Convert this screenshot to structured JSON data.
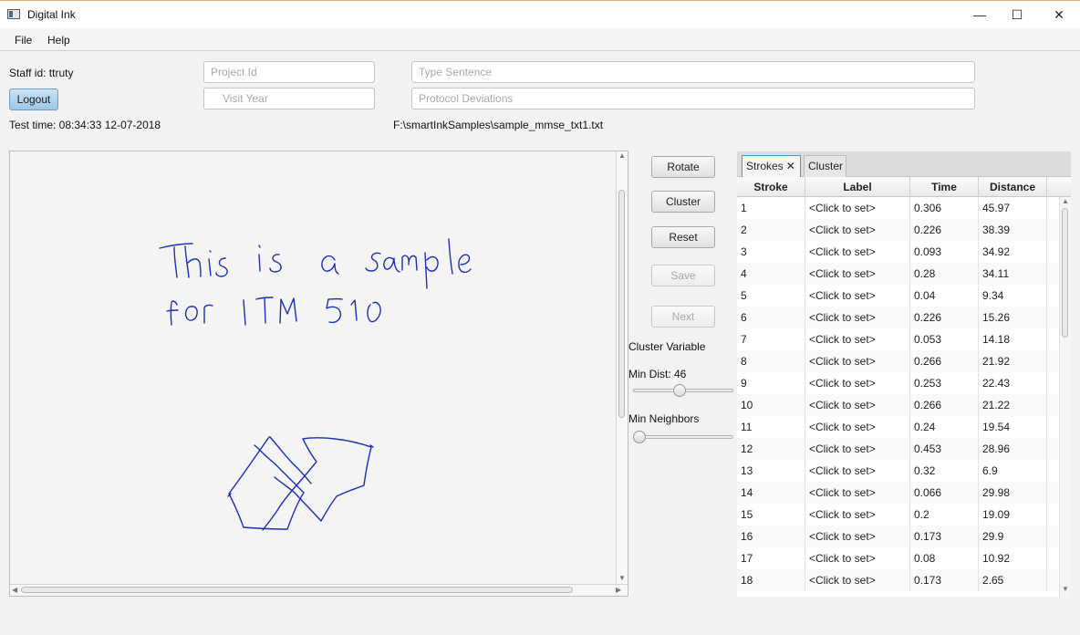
{
  "window": {
    "title": "Digital Ink",
    "minimize": "—",
    "maximize": "☐",
    "close": "✕"
  },
  "menu": {
    "file": "File",
    "help": "Help"
  },
  "header": {
    "staff": "Staff id: ttruty",
    "logout": "Logout",
    "test_time": "Test time: 08:34:33 12-07-2018",
    "file_path": "F:\\smartInkSamples\\sample_mmse_txt1.txt",
    "project_id_placeholder": "Project Id",
    "visit_year_placeholder": "Visit Year",
    "type_sentence_placeholder": "Type Sentence",
    "protocol_placeholder": "Protocol Deviations"
  },
  "controls": {
    "rotate": "Rotate",
    "cluster": "Cluster",
    "reset": "Reset",
    "save": "Save",
    "next": "Next",
    "cluster_variable": "Cluster  Variable",
    "min_dist_label": "Min Dist: 46",
    "min_neighbors_label": "Min Neighbors",
    "min_dist_slider_fraction": 0.46,
    "min_neighbors_slider_fraction": 0.0
  },
  "tabs": {
    "strokes": "Strokes",
    "cluster": "Cluster"
  },
  "table": {
    "headers": [
      "Stroke",
      "Label",
      "Time",
      "Distance"
    ],
    "rows": [
      [
        "1",
        "<Click to set>",
        "0.306",
        "45.97"
      ],
      [
        "2",
        "<Click to set>",
        "0.226",
        "38.39"
      ],
      [
        "3",
        "<Click to set>",
        "0.093",
        "34.92"
      ],
      [
        "4",
        "<Click to set>",
        "0.28",
        "34.11"
      ],
      [
        "5",
        "<Click to set>",
        "0.04",
        "9.34"
      ],
      [
        "6",
        "<Click to set>",
        "0.226",
        "15.26"
      ],
      [
        "7",
        "<Click to set>",
        "0.053",
        "14.18"
      ],
      [
        "8",
        "<Click to set>",
        "0.266",
        "21.92"
      ],
      [
        "9",
        "<Click to set>",
        "0.253",
        "22.43"
      ],
      [
        "10",
        "<Click to set>",
        "0.266",
        "21.22"
      ],
      [
        "11",
        "<Click to set>",
        "0.24",
        "19.54"
      ],
      [
        "12",
        "<Click to set>",
        "0.453",
        "28.96"
      ],
      [
        "13",
        "<Click to set>",
        "0.32",
        "6.9"
      ],
      [
        "14",
        "<Click to set>",
        "0.066",
        "29.98"
      ],
      [
        "15",
        "<Click to set>",
        "0.2",
        "19.09"
      ],
      [
        "16",
        "<Click to set>",
        "0.173",
        "29.9"
      ],
      [
        "17",
        "<Click to set>",
        "0.08",
        "10.92"
      ],
      [
        "18",
        "<Click to set>",
        "0.173",
        "2.65"
      ]
    ]
  },
  "colors": {
    "ink": "#1a2fb8",
    "accent": "#4d9ad0"
  }
}
